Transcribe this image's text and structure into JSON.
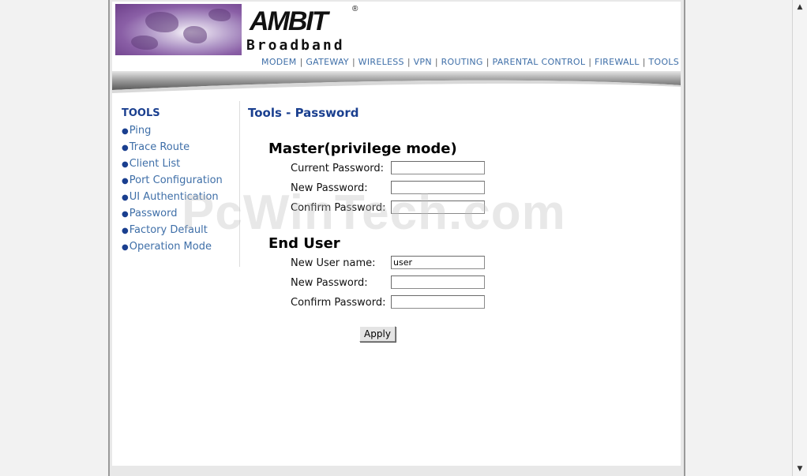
{
  "logo": {
    "brand": "AMBIT",
    "registered": "®",
    "tagline": "Broadband"
  },
  "topnav": {
    "items": [
      {
        "label": "MODEM"
      },
      {
        "label": "GATEWAY"
      },
      {
        "label": "WIRELESS"
      },
      {
        "label": "VPN"
      },
      {
        "label": "ROUTING"
      },
      {
        "label": "PARENTAL CONTROL"
      },
      {
        "label": "FIREWALL"
      },
      {
        "label": "TOOLS"
      }
    ],
    "separator": "|"
  },
  "sidebar": {
    "title": "TOOLS",
    "bullet": "●",
    "items": [
      {
        "label": "Ping"
      },
      {
        "label": "Trace Route"
      },
      {
        "label": "Client List"
      },
      {
        "label": "Port Configuration"
      },
      {
        "label": "UI Authentication"
      },
      {
        "label": "Password"
      },
      {
        "label": "Factory Default"
      },
      {
        "label": "Operation Mode"
      }
    ]
  },
  "main": {
    "title": "Tools - Password",
    "master": {
      "heading": "Master(privilege mode)",
      "current_password_label": "Current Password:",
      "current_password_value": "",
      "new_password_label": "New Password:",
      "new_password_value": "",
      "confirm_password_label": "Confirm Password:",
      "confirm_password_value": ""
    },
    "end_user": {
      "heading": "End User",
      "new_user_name_label": "New User name:",
      "new_user_name_value": "user",
      "new_password_label": "New Password:",
      "new_password_value": "",
      "confirm_password_label": "Confirm Password:",
      "confirm_password_value": ""
    },
    "apply_label": "Apply"
  },
  "watermark": "PcWinTech.com",
  "scrollbar": {
    "up_glyph": "▲",
    "down_glyph": "▼"
  },
  "colors": {
    "nav_link": "#3f6fa8",
    "heading_blue": "#1a3f8f",
    "logo_purple": "#8a5fa6"
  }
}
